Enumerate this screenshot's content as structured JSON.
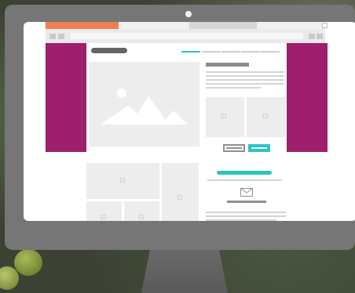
{
  "colors": {
    "accent_tab": "#f07f54",
    "sidebar": "#9e1f6b",
    "teal": "#29c6c6",
    "placeholder": "#ededed",
    "monitor_bezel": "#767676"
  },
  "icons": {
    "hero": "image-placeholder-icon",
    "thumbnails": "camera-icon",
    "contact": "envelope-icon"
  },
  "placeholder_glyph": "⊡"
}
